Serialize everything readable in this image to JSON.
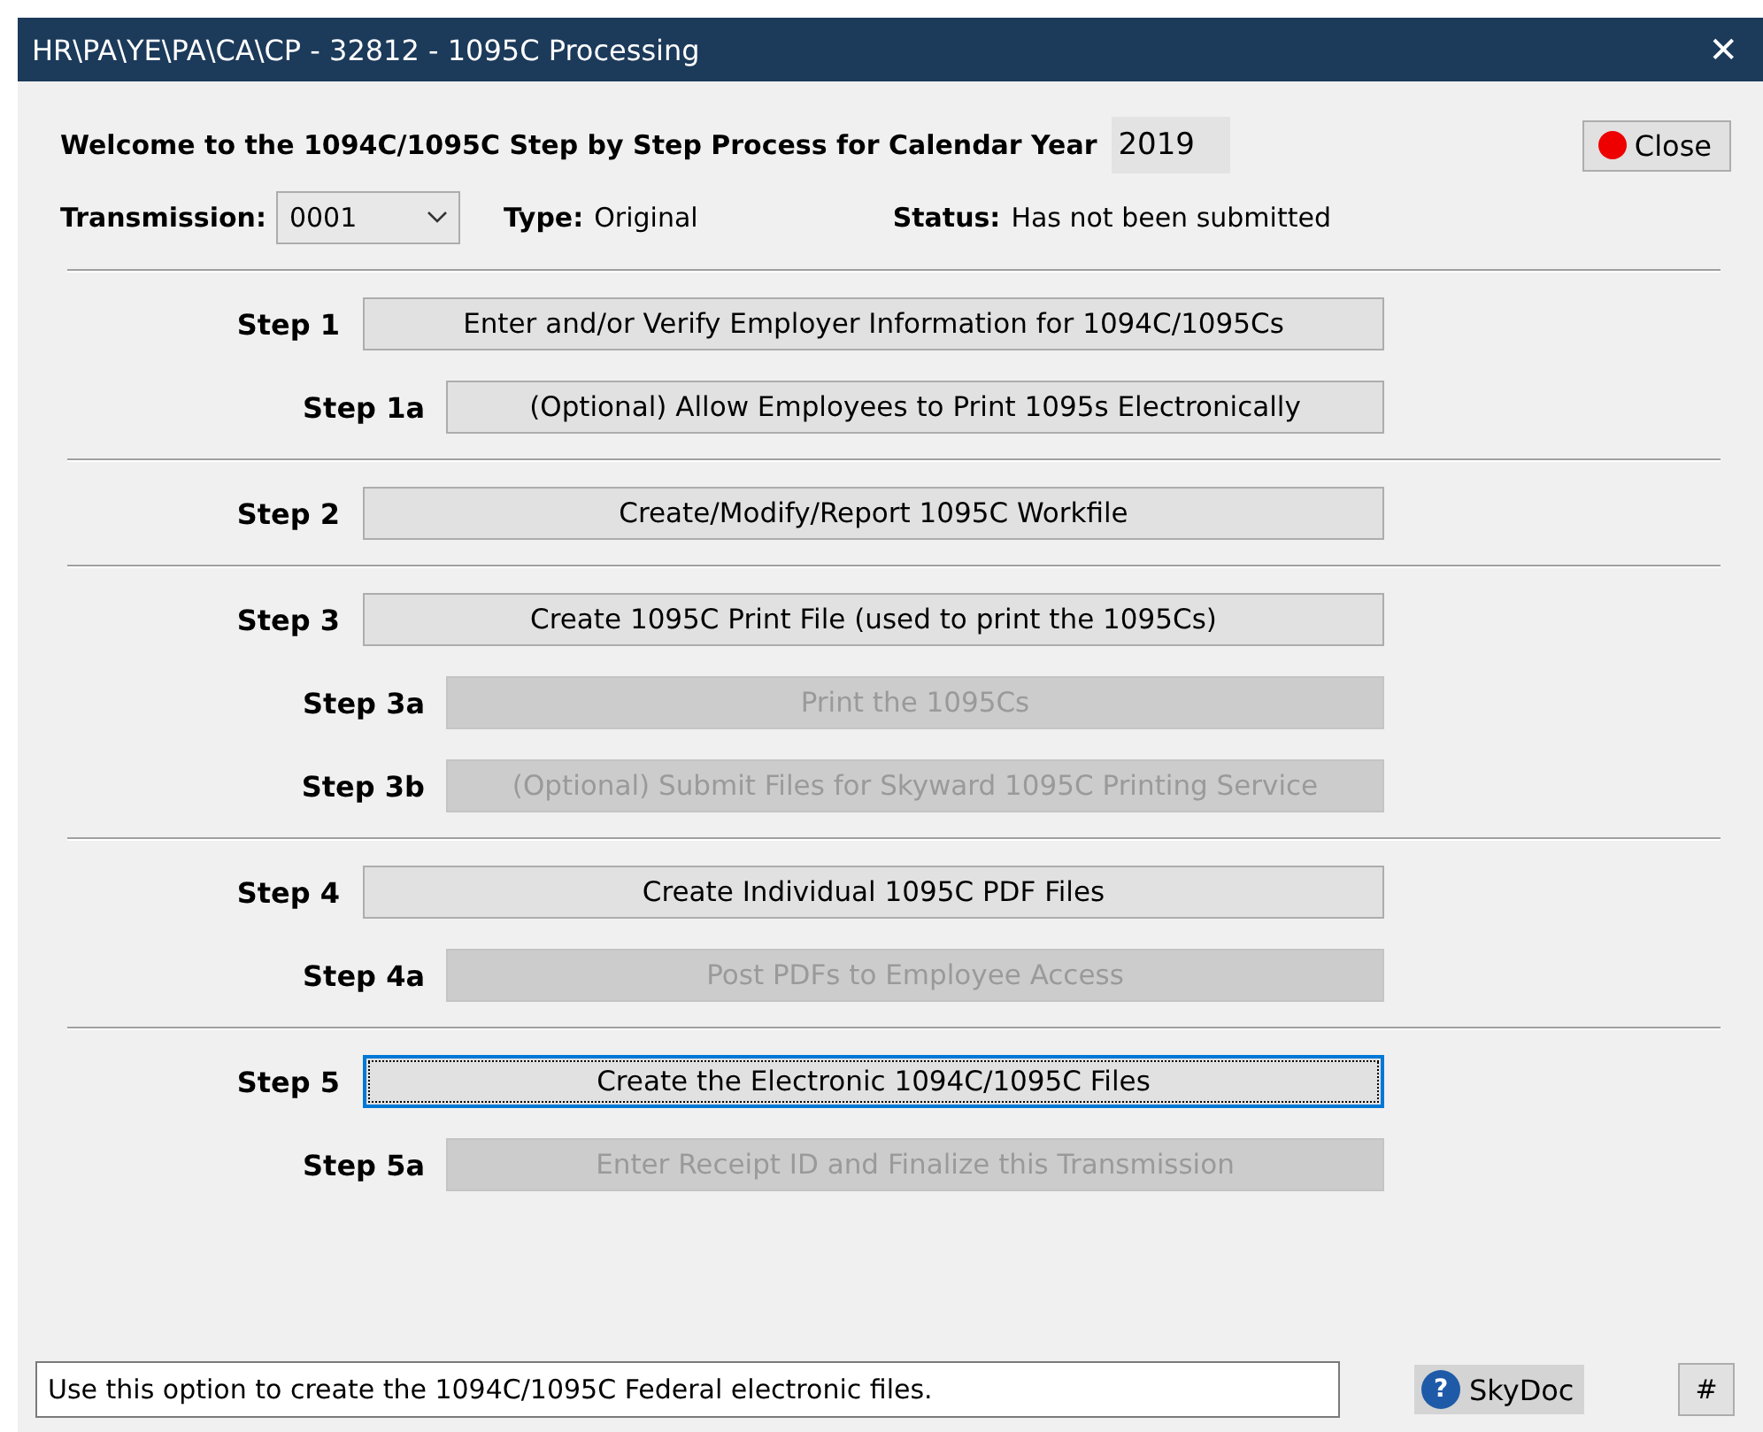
{
  "window": {
    "title": "HR\\PA\\YE\\PA\\CA\\CP - 32812 - 1095C Processing",
    "close": "✕"
  },
  "header": {
    "welcome": "Welcome to the 1094C/1095C Step by Step Process for Calendar Year",
    "year": "2019",
    "close_button": "Close",
    "transmission_label": "Transmission:",
    "transmission_value": "0001",
    "type_label": "Type:",
    "type_value": "Original",
    "status_label": "Status:",
    "status_value": "Has not been submitted"
  },
  "groups": [
    {
      "steps": [
        {
          "kind": "main",
          "label": "Step 1",
          "button": "Enter and/or Verify Employer Information for 1094C/1095Cs",
          "disabled": false,
          "focused": false
        },
        {
          "kind": "sub",
          "label": "Step 1a",
          "button": "(Optional)  Allow Employees to Print 1095s Electronically",
          "disabled": false,
          "focused": false
        }
      ]
    },
    {
      "steps": [
        {
          "kind": "main",
          "label": "Step 2",
          "button": "Create/Modify/Report 1095C Workfile",
          "disabled": false,
          "focused": false
        }
      ]
    },
    {
      "steps": [
        {
          "kind": "main",
          "label": "Step 3",
          "button": "Create 1095C Print File (used to print the 1095Cs)",
          "disabled": false,
          "focused": false
        },
        {
          "kind": "sub",
          "label": "Step 3a",
          "button": "Print the 1095Cs",
          "disabled": true,
          "focused": false
        },
        {
          "kind": "sub",
          "label": "Step 3b",
          "button": "(Optional)  Submit Files for Skyward 1095C Printing Service",
          "disabled": true,
          "focused": false
        }
      ]
    },
    {
      "steps": [
        {
          "kind": "main",
          "label": "Step 4",
          "button": "Create Individual 1095C PDF Files",
          "disabled": false,
          "focused": false
        },
        {
          "kind": "sub",
          "label": "Step 4a",
          "button": "Post PDFs to Employee Access",
          "disabled": true,
          "focused": false
        }
      ]
    },
    {
      "steps": [
        {
          "kind": "main",
          "label": "Step 5",
          "button": "Create the Electronic 1094C/1095C Files",
          "disabled": false,
          "focused": true
        },
        {
          "kind": "sub",
          "label": "Step 5a",
          "button": "Enter Receipt ID and Finalize this Transmission",
          "disabled": true,
          "focused": false
        }
      ]
    }
  ],
  "status_bar": {
    "message": "Use this option to create the 1094C/1095C Federal electronic files.",
    "help_icon": "?",
    "skydoc": "SkyDoc",
    "hash": "#"
  }
}
